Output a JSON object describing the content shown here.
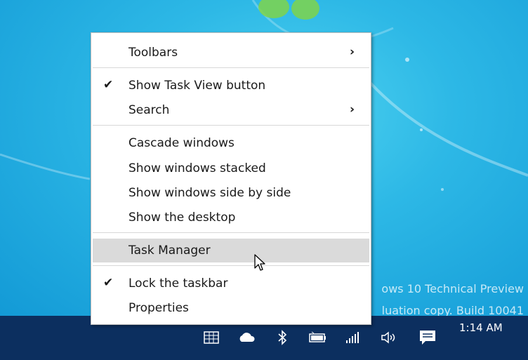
{
  "desktop": {
    "watermark_line1": "ows 10 Technical Preview",
    "watermark_line2": "luation copy. Build 10041"
  },
  "context_menu": {
    "items": [
      {
        "label": "Toolbars",
        "checked": false,
        "submenu": true
      },
      {
        "label": "Show Task View button",
        "checked": true,
        "submenu": false
      },
      {
        "label": "Search",
        "checked": false,
        "submenu": true
      },
      {
        "label": "Cascade windows",
        "checked": false,
        "submenu": false
      },
      {
        "label": "Show windows stacked",
        "checked": false,
        "submenu": false
      },
      {
        "label": "Show windows side by side",
        "checked": false,
        "submenu": false
      },
      {
        "label": "Show the desktop",
        "checked": false,
        "submenu": false
      },
      {
        "label": "Task Manager",
        "checked": false,
        "submenu": false,
        "highlighted": true
      },
      {
        "label": "Lock the taskbar",
        "checked": true,
        "submenu": false
      },
      {
        "label": "Properties",
        "checked": false,
        "submenu": false
      }
    ],
    "check_glyph": "✔",
    "submenu_glyph": "›"
  },
  "taskbar": {
    "tray_icons": [
      "network-grid-icon",
      "onedrive-cloud-icon",
      "bluetooth-icon",
      "battery-icon",
      "signal-strength-icon",
      "volume-icon",
      "action-center-icon"
    ],
    "clock": "1:14 AM"
  },
  "colors": {
    "desktop_bg": "#2db8e6",
    "taskbar_bg": "#0c2f5f",
    "menu_bg": "#ffffff",
    "menu_highlight": "#dadada"
  }
}
